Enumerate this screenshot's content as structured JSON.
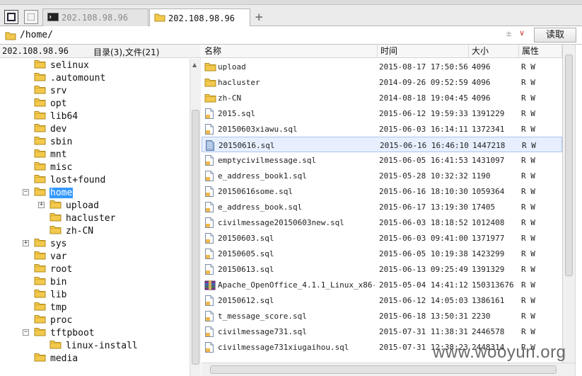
{
  "tabs": [
    {
      "label": "202.108.98.96",
      "active": false
    },
    {
      "label": "202.108.98.96",
      "active": true
    }
  ],
  "toolbar": {
    "add_tab": "+"
  },
  "address": {
    "path": "/home/",
    "history_symbol": "±",
    "dropdown_symbol": "∨",
    "read_button": "读取"
  },
  "left": {
    "host": "202.108.98.96",
    "counts": "目录(3),文件(21)",
    "tree": [
      {
        "name": "selinux",
        "level": 0,
        "expander": ""
      },
      {
        "name": ".automount",
        "level": 0,
        "expander": ""
      },
      {
        "name": "srv",
        "level": 0,
        "expander": ""
      },
      {
        "name": "opt",
        "level": 0,
        "expander": ""
      },
      {
        "name": "lib64",
        "level": 0,
        "expander": ""
      },
      {
        "name": "dev",
        "level": 0,
        "expander": ""
      },
      {
        "name": "sbin",
        "level": 0,
        "expander": ""
      },
      {
        "name": "mnt",
        "level": 0,
        "expander": ""
      },
      {
        "name": "misc",
        "level": 0,
        "expander": ""
      },
      {
        "name": "lost+found",
        "level": 0,
        "expander": ""
      },
      {
        "name": "home",
        "level": 0,
        "expander": "−",
        "selected": true,
        "open": true
      },
      {
        "name": "upload",
        "level": 1,
        "expander": "+"
      },
      {
        "name": "hacluster",
        "level": 1,
        "expander": ""
      },
      {
        "name": "zh-CN",
        "level": 1,
        "expander": ""
      },
      {
        "name": "sys",
        "level": 0,
        "expander": "+"
      },
      {
        "name": "var",
        "level": 0,
        "expander": ""
      },
      {
        "name": "root",
        "level": 0,
        "expander": ""
      },
      {
        "name": "bin",
        "level": 0,
        "expander": ""
      },
      {
        "name": "lib",
        "level": 0,
        "expander": ""
      },
      {
        "name": "tmp",
        "level": 0,
        "expander": ""
      },
      {
        "name": "proc",
        "level": 0,
        "expander": ""
      },
      {
        "name": "tftpboot",
        "level": 0,
        "expander": "−",
        "open": true
      },
      {
        "name": "linux-install",
        "level": 1,
        "expander": ""
      },
      {
        "name": "media",
        "level": 0,
        "expander": ""
      }
    ]
  },
  "columns": {
    "name": "名称",
    "time": "时间",
    "size": "大小",
    "attr": "属性"
  },
  "files": [
    {
      "name": "upload",
      "time": "2015-08-17 17:50:56",
      "size": "4096",
      "attr": "R W",
      "type": "folder"
    },
    {
      "name": "hacluster",
      "time": "2014-09-26 09:52:59",
      "size": "4096",
      "attr": "R W",
      "type": "folder"
    },
    {
      "name": "zh-CN",
      "time": "2014-08-18 19:04:45",
      "size": "4096",
      "attr": "R W",
      "type": "folder"
    },
    {
      "name": "2015.sql",
      "time": "2015-06-12 19:59:33",
      "size": "1391229",
      "attr": "R W",
      "type": "file"
    },
    {
      "name": "20150603xiawu.sql",
      "time": "2015-06-03 16:14:11",
      "size": "1372341",
      "attr": "R W",
      "type": "file"
    },
    {
      "name": "20150616.sql",
      "time": "2015-06-16 16:46:10",
      "size": "1447218",
      "attr": "R W",
      "type": "file-selected",
      "selected": true
    },
    {
      "name": "emptycivilmessage.sql",
      "time": "2015-06-05 16:41:53",
      "size": "1431097",
      "attr": "R W",
      "type": "file"
    },
    {
      "name": "e_address_book1.sql",
      "time": "2015-05-28 10:32:32",
      "size": "1190",
      "attr": "R W",
      "type": "file"
    },
    {
      "name": "20150616some.sql",
      "time": "2015-06-16 18:10:30",
      "size": "1059364",
      "attr": "R W",
      "type": "file"
    },
    {
      "name": "e_address_book.sql",
      "time": "2015-06-17 13:19:30",
      "size": "17405",
      "attr": "R W",
      "type": "file"
    },
    {
      "name": "civilmessage20150603new.sql",
      "time": "2015-06-03 18:18:52",
      "size": "1012408",
      "attr": "R W",
      "type": "file"
    },
    {
      "name": "20150603.sql",
      "time": "2015-06-03 09:41:00",
      "size": "1371977",
      "attr": "R W",
      "type": "file"
    },
    {
      "name": "20150605.sql",
      "time": "2015-06-05 10:19:38",
      "size": "1423299",
      "attr": "R W",
      "type": "file"
    },
    {
      "name": "20150613.sql",
      "time": "2015-06-13 09:25:49",
      "size": "1391329",
      "attr": "R W",
      "type": "file"
    },
    {
      "name": "Apache_OpenOffice_4.1.1_Linux_x86-...",
      "time": "2015-05-04 14:41:12",
      "size": "150313676",
      "attr": "R W",
      "type": "archive"
    },
    {
      "name": "20150612.sql",
      "time": "2015-06-12 14:05:03",
      "size": "1386161",
      "attr": "R W",
      "type": "file"
    },
    {
      "name": "t_message_score.sql",
      "time": "2015-06-18 13:50:31",
      "size": "2230",
      "attr": "R W",
      "type": "file"
    },
    {
      "name": "civilmessage731.sql",
      "time": "2015-07-31 11:38:31",
      "size": "2446578",
      "attr": "R W",
      "type": "file"
    },
    {
      "name": "civilmessage731xiugaihou.sql",
      "time": "2015-07-31 12:38:23",
      "size": "2448314",
      "attr": "R W",
      "type": "file"
    }
  ],
  "watermark": "www.wooyun.org",
  "colors": {
    "selection": "#3399ff",
    "row_selection": "#e7efff",
    "folder": "#f2c94c"
  }
}
